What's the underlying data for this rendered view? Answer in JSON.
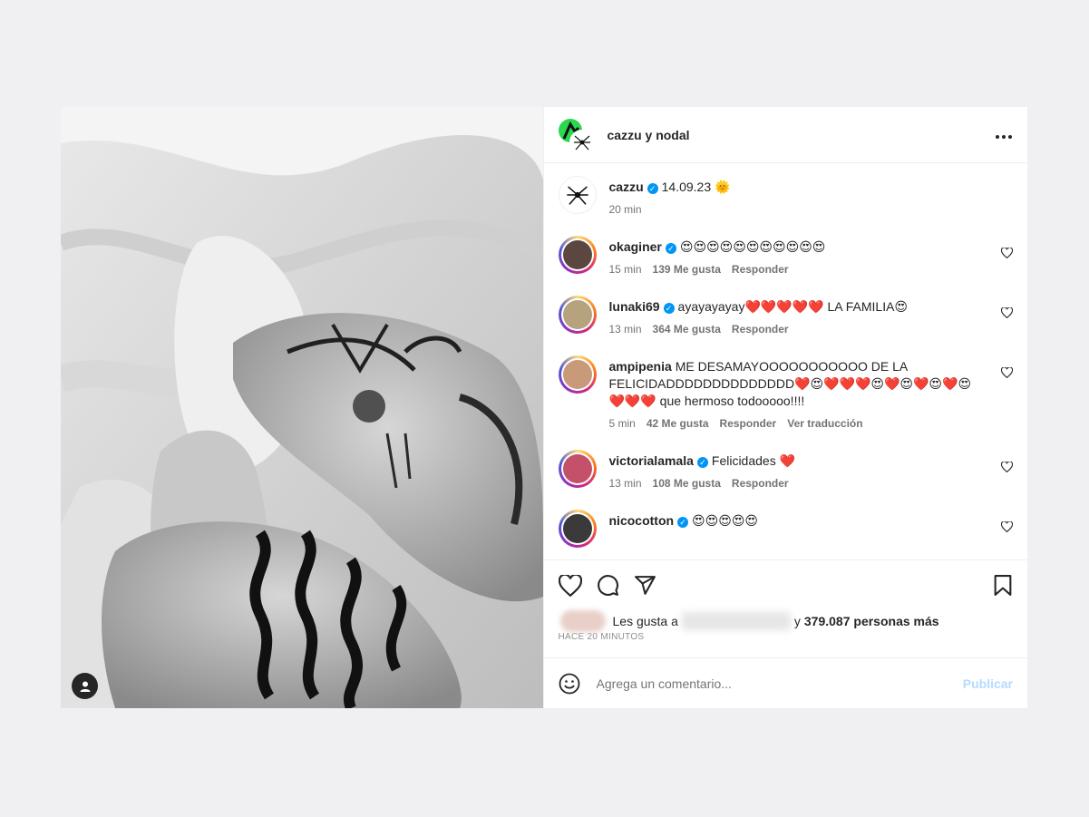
{
  "header": {
    "title": "cazzu y nodal",
    "more_label": "•••"
  },
  "caption": {
    "username": "cazzu",
    "text": "14.09.23 🌞",
    "time": "20 min"
  },
  "comments": [
    {
      "username": "okaginer",
      "verified": true,
      "text": "😍😍😍😍😍😍😍😍😍😍😍",
      "time": "15 min",
      "likes": "139 Me gusta",
      "reply": "Responder",
      "avatar_color": "#5b4640"
    },
    {
      "username": "lunaki69",
      "verified": true,
      "text": "ayayayayay❤️❤️❤️❤️❤️ LA FAMILIA😍",
      "time": "13 min",
      "likes": "364 Me gusta",
      "reply": "Responder",
      "avatar_color": "#b7a27e"
    },
    {
      "username": "ampipenia",
      "verified": false,
      "text": "ME DESAMAYOOOOOOOOOOO DE LA FELICIDADDDDDDDDDDDDDD❤️😍❤️❤️❤️😍❤️😍❤️😍❤️😍❤️❤️❤️ que hermoso todooooo!!!!",
      "time": "5 min",
      "likes": "42 Me gusta",
      "reply": "Responder",
      "translate": "Ver traducción",
      "avatar_color": "#c89a7a"
    },
    {
      "username": "victorialamala",
      "verified": true,
      "text": "Felicidades ❤️",
      "time": "13 min",
      "likes": "108 Me gusta",
      "reply": "Responder",
      "avatar_color": "#c4506a"
    },
    {
      "username": "nicocotton",
      "verified": true,
      "text": "😍😍😍😍😍",
      "time": "",
      "likes": "",
      "reply": "",
      "avatar_color": "#3a3a3a"
    }
  ],
  "likes": {
    "prefix": "Les gusta a",
    "suffix": "y",
    "count": "379.087 personas más",
    "time_ago": "HACE 20 MINUTOS"
  },
  "add_comment": {
    "placeholder": "Agrega un comentario...",
    "publish": "Publicar"
  },
  "icons": [
    "heart-icon",
    "comment-icon",
    "share-icon",
    "bookmark-icon",
    "emoji-icon",
    "user-tag-icon",
    "more-icon"
  ],
  "colors": {
    "accent": "#0095f6",
    "publish_disabled": "#b3dbff",
    "story_ring": "#d62976"
  }
}
